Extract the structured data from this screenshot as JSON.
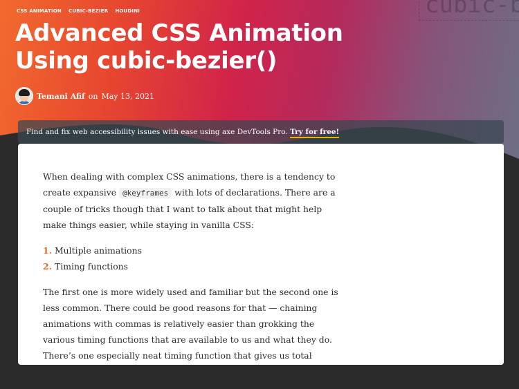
{
  "hero": {
    "tags": [
      "CSS ANIMATION",
      "CUBIC-BEZIER",
      "HOUDINI"
    ],
    "decor_text": "cubic-be",
    "title_line1": "Advanced CSS Animation",
    "title_line2": "Using cubic-bezier()",
    "author": "Temani Afif",
    "date_prefix": "on",
    "date": "May 13, 2021"
  },
  "promo": {
    "text": "Find and fix web accessibility issues with ease using axe DevTools Pro.",
    "cta": "Try for free!"
  },
  "article": {
    "p1_before": "When dealing with complex CSS animations, there is a tendency to create expansive",
    "p1_code": "@keyframes",
    "p1_after": "with lots of declarations. There are a couple of tricks though that I want to talk about that might help make things easier, while staying in vanilla CSS:",
    "list": [
      {
        "num": "1.",
        "text": "Multiple animations"
      },
      {
        "num": "2.",
        "text": "Timing functions"
      }
    ],
    "p2": "The first one is more widely used and familiar but the second one is less common. There could be good reasons for that — chaining animations with commas is relatively easier than grokking the various timing functions that are available to us and what they do. There’s one especially neat timing function that gives us total control to create custom timing"
  },
  "colors": {
    "accent_orange": "#e76a25",
    "cta_underline": "#f0b000",
    "dark_bg": "#2b2b2b"
  }
}
